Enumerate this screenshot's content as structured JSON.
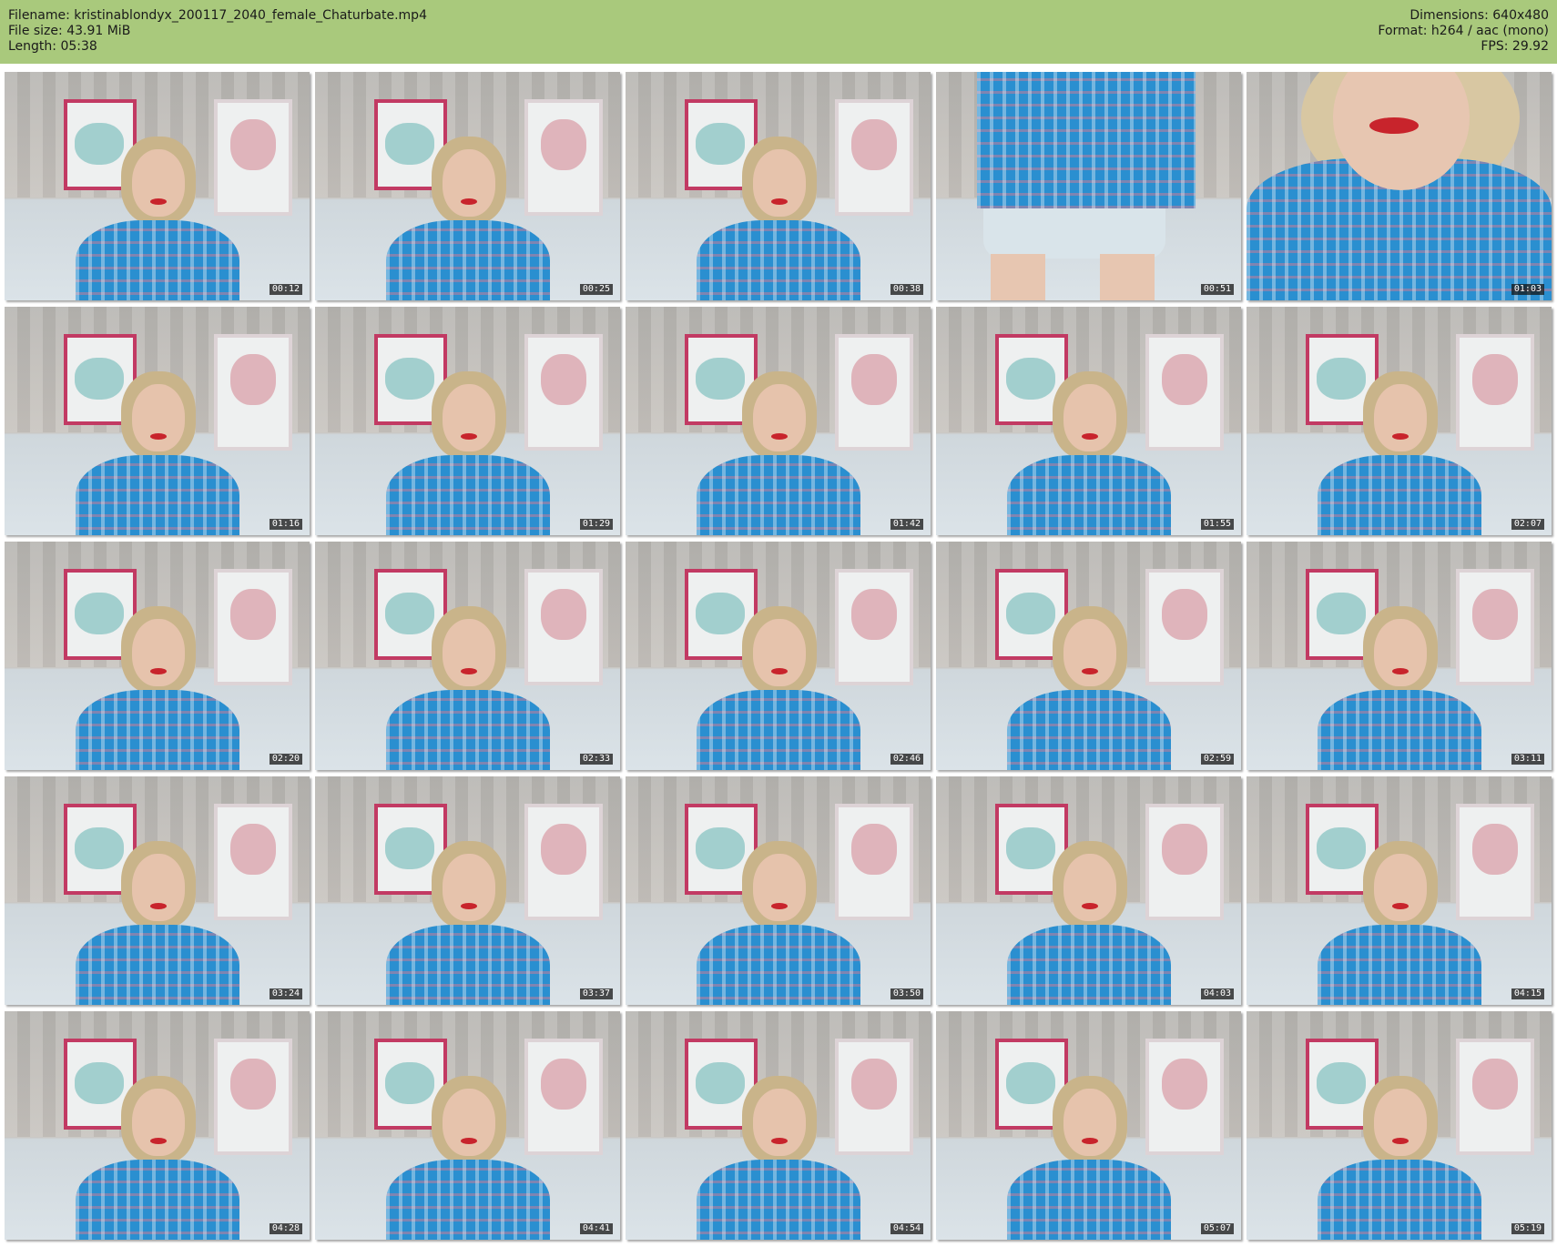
{
  "header": {
    "filename": "Filename: kristinablondyx_200117_2040_female_Chaturbate.mp4",
    "filesize": "File size: 43.91 MiB",
    "length": "Length: 05:38",
    "dimensions": "Dimensions: 640x480",
    "format": "Format: h264 / aac (mono)",
    "fps": "FPS: 29.92"
  },
  "colors": {
    "header_bg": "#a9c97c",
    "shirt": "#2a8fd0",
    "poster_frame": "#c23a63"
  },
  "thumbnails": [
    {
      "time": "00:12",
      "variant": "normal"
    },
    {
      "time": "00:25",
      "variant": "normal"
    },
    {
      "time": "00:38",
      "variant": "normal"
    },
    {
      "time": "00:51",
      "variant": "legs"
    },
    {
      "time": "01:03",
      "variant": "face-close"
    },
    {
      "time": "01:16",
      "variant": "normal"
    },
    {
      "time": "01:29",
      "variant": "normal"
    },
    {
      "time": "01:42",
      "variant": "normal"
    },
    {
      "time": "01:55",
      "variant": "normal"
    },
    {
      "time": "02:07",
      "variant": "normal"
    },
    {
      "time": "02:20",
      "variant": "normal"
    },
    {
      "time": "02:33",
      "variant": "normal"
    },
    {
      "time": "02:46",
      "variant": "normal"
    },
    {
      "time": "02:59",
      "variant": "normal"
    },
    {
      "time": "03:11",
      "variant": "normal"
    },
    {
      "time": "03:24",
      "variant": "normal"
    },
    {
      "time": "03:37",
      "variant": "normal"
    },
    {
      "time": "03:50",
      "variant": "normal"
    },
    {
      "time": "04:03",
      "variant": "normal"
    },
    {
      "time": "04:15",
      "variant": "normal"
    },
    {
      "time": "04:28",
      "variant": "normal"
    },
    {
      "time": "04:41",
      "variant": "normal"
    },
    {
      "time": "04:54",
      "variant": "normal"
    },
    {
      "time": "05:07",
      "variant": "normal"
    },
    {
      "time": "05:19",
      "variant": "normal"
    }
  ]
}
